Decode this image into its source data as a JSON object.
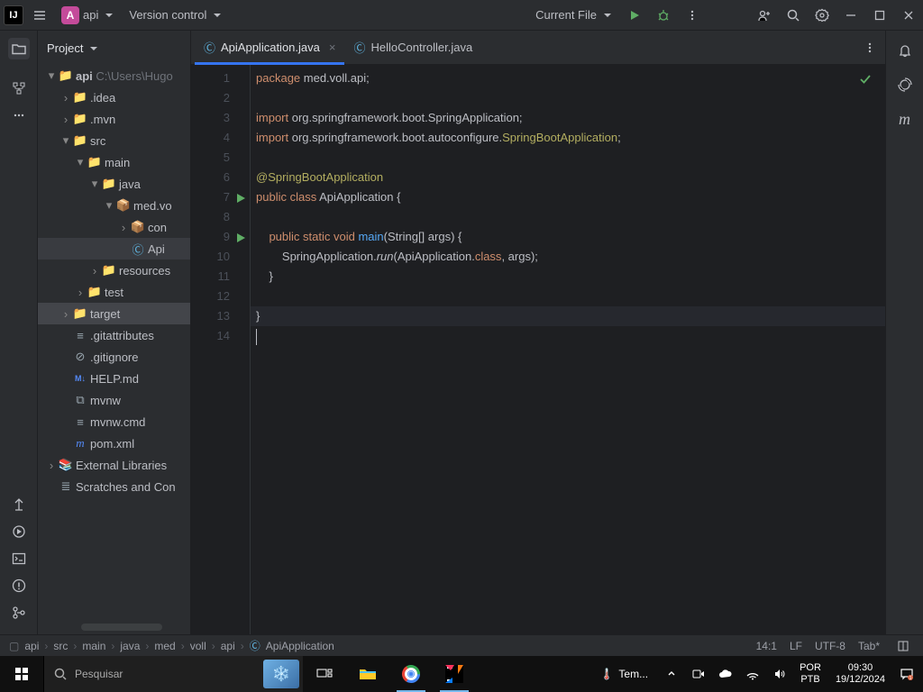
{
  "menubar": {
    "project_badge": "A",
    "project_name": "api",
    "vcs_label": "Version control",
    "run_config": "Current File"
  },
  "project": {
    "title": "Project",
    "root": "api",
    "root_path": "C:\\Users\\Hugo",
    "items": {
      "idea": ".idea",
      "mvn": ".mvn",
      "src": "src",
      "main": "main",
      "java": "java",
      "pkg": "med.vo",
      "con": "con",
      "api": "Api",
      "resources": "resources",
      "test": "test",
      "target": "target",
      "gitattr": ".gitattributes",
      "gitign": ".gitignore",
      "help": "HELP.md",
      "mvnw": "mvnw",
      "mvnwcmd": "mvnw.cmd",
      "pom": "pom.xml",
      "extlib": "External Libraries",
      "scratch": "Scratches and Con"
    }
  },
  "tabs": {
    "t1": "ApiApplication.java",
    "t2": "HelloController.java"
  },
  "code": {
    "lines": [
      {
        "n": 1,
        "seg": [
          [
            "kw",
            "package"
          ],
          [
            "",
            " med.voll.api;"
          ]
        ]
      },
      {
        "n": 2,
        "seg": [
          [
            "",
            ""
          ]
        ]
      },
      {
        "n": 3,
        "seg": [
          [
            "kw",
            "import"
          ],
          [
            "",
            " org.springframework.boot.SpringApplication;"
          ]
        ]
      },
      {
        "n": 4,
        "seg": [
          [
            "kw",
            "import"
          ],
          [
            "",
            " org.springframework.boot.autoconfigure."
          ],
          [
            "an",
            "SpringBootApplication"
          ],
          [
            "",
            ";"
          ]
        ]
      },
      {
        "n": 5,
        "seg": [
          [
            "",
            ""
          ]
        ]
      },
      {
        "n": 6,
        "seg": [
          [
            "an",
            "@SpringBootApplication"
          ]
        ]
      },
      {
        "n": 7,
        "run": true,
        "seg": [
          [
            "kw",
            "public class"
          ],
          [
            "",
            " ApiApplication {"
          ]
        ]
      },
      {
        "n": 8,
        "seg": [
          [
            "",
            ""
          ]
        ]
      },
      {
        "n": 9,
        "run": true,
        "seg": [
          [
            "",
            "    "
          ],
          [
            "kw",
            "public static void"
          ],
          [
            "",
            " "
          ],
          [
            "fn",
            "main"
          ],
          [
            "",
            "(String[] args) {"
          ]
        ]
      },
      {
        "n": 10,
        "seg": [
          [
            "",
            "        SpringApplication."
          ],
          [
            "it",
            "run"
          ],
          [
            "",
            "(ApiApplication."
          ],
          [
            "kw",
            "class"
          ],
          [
            "",
            ", args);"
          ]
        ]
      },
      {
        "n": 11,
        "seg": [
          [
            "",
            "    }"
          ]
        ]
      },
      {
        "n": 12,
        "seg": [
          [
            "",
            ""
          ]
        ]
      },
      {
        "n": 13,
        "seg": [
          [
            "",
            "}"
          ]
        ],
        "hl": true
      },
      {
        "n": 14,
        "seg": [
          [
            "",
            ""
          ]
        ],
        "caret": true
      }
    ]
  },
  "crumbs": [
    "api",
    "src",
    "main",
    "java",
    "med",
    "voll",
    "api",
    "ApiApplication"
  ],
  "status": {
    "pos": "14:1",
    "sep": "LF",
    "enc": "UTF-8",
    "indent": "Tab*"
  },
  "taskbar": {
    "search_placeholder": "Pesquisar",
    "weather": "Tem...",
    "lang1": "POR",
    "lang2": "PTB",
    "time": "09:30",
    "date": "19/12/2024"
  }
}
